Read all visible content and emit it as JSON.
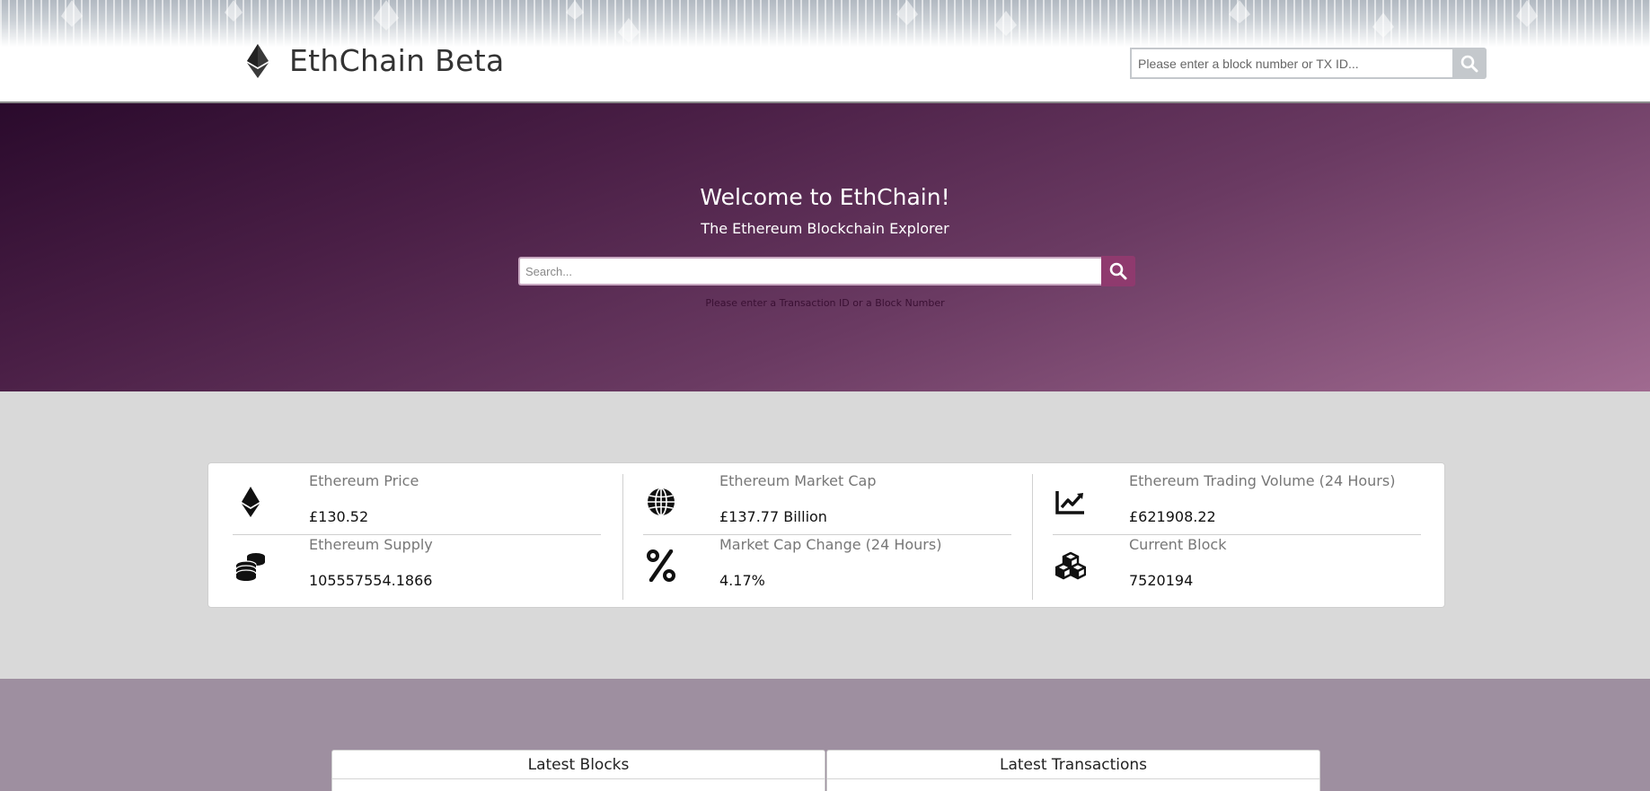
{
  "header": {
    "brand_title": "EthChain Beta",
    "search_placeholder": "Please enter a block number or TX ID...",
    "search_icon": "search-icon"
  },
  "hero": {
    "title": "Welcome to EthChain!",
    "subtitle": "The Ethereum Blockchain Explorer",
    "search_placeholder": "Search...",
    "hint": "Please enter a Transaction ID or a Block Number",
    "accent_color": "#8f3a6e"
  },
  "stats": [
    {
      "icon": "ethereum-icon",
      "label": "Ethereum Price",
      "value": "£130.52"
    },
    {
      "icon": "coins-icon",
      "label": "Ethereum Supply",
      "value": "105557554.1866"
    },
    {
      "icon": "globe-icon",
      "label": "Ethereum Market Cap",
      "value": "£137.77 Billion"
    },
    {
      "icon": "percent-icon",
      "label": "Market Cap Change (24 Hours)",
      "value": "4.17%"
    },
    {
      "icon": "chart-line-icon",
      "label": "Ethereum Trading Volume (24 Hours)",
      "value": "£621908.22"
    },
    {
      "icon": "cubes-icon",
      "label": "Current Block",
      "value": "7520194"
    }
  ],
  "panels": {
    "latest_blocks": "Latest Blocks",
    "latest_transactions": "Latest Transactions"
  }
}
